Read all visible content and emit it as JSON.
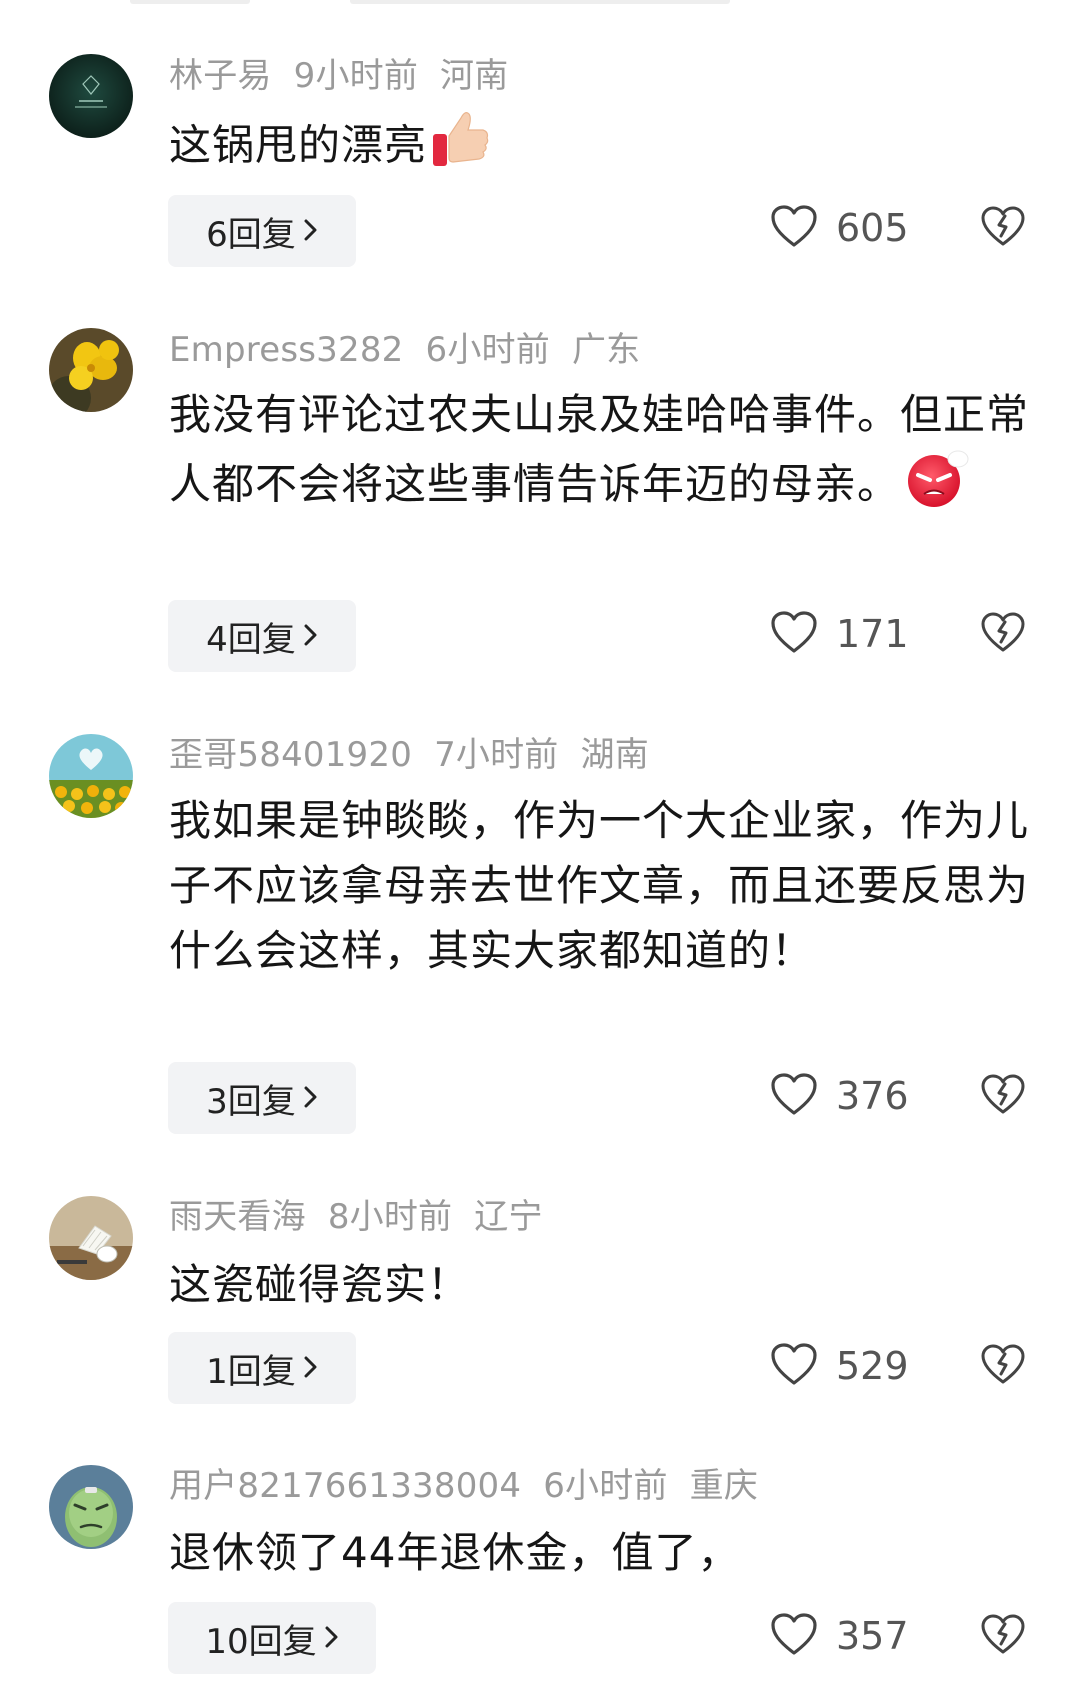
{
  "comments": [
    {
      "username": "林子易",
      "time": "9小时前",
      "region": "河南",
      "text": "这锅甩的漂亮",
      "emoji": "thumbs-up",
      "reply_label": "6回复",
      "likes": "605",
      "avatar": "dark-green-logo"
    },
    {
      "username": "Empress3282",
      "time": "6小时前",
      "region": "广东",
      "text": "我没有评论过农夫山泉及娃哈哈事件。但正常人都不会将这些事情告诉年迈的母亲。",
      "emoji": "angry-face",
      "reply_label": "4回复",
      "likes": "171",
      "avatar": "yellow-flowers"
    },
    {
      "username": "歪哥58401920",
      "time": "7小时前",
      "region": "湖南",
      "text": "我如果是钟睒睒，作为一个大企业家，作为儿子不应该拿母亲去世作文章，而且还要反思为什么会这样，其实大家都知道的！",
      "emoji": "",
      "reply_label": "3回复",
      "likes": "376",
      "avatar": "sunflower-field"
    },
    {
      "username": "雨天看海",
      "time": "8小时前",
      "region": "辽宁",
      "text": "这瓷碰得瓷实！",
      "emoji": "",
      "reply_label": "1回复",
      "likes": "529",
      "avatar": "shuttlecock"
    },
    {
      "username": "用户8217661338004",
      "time": "6小时前",
      "region": "重庆",
      "text": "退休领了44年退休金，值了，",
      "emoji": "",
      "reply_label": "10回复",
      "likes": "357",
      "avatar": "green-cartoon"
    }
  ],
  "icons": {
    "like": "heart-outline-icon",
    "dislike": "broken-heart-icon",
    "reply_chevron": "chevron-right-icon"
  },
  "colors": {
    "meta_text": "#9a9a9a",
    "body_text": "#161616",
    "reply_bg": "#f2f3f5",
    "icon_stroke": "#444444"
  }
}
